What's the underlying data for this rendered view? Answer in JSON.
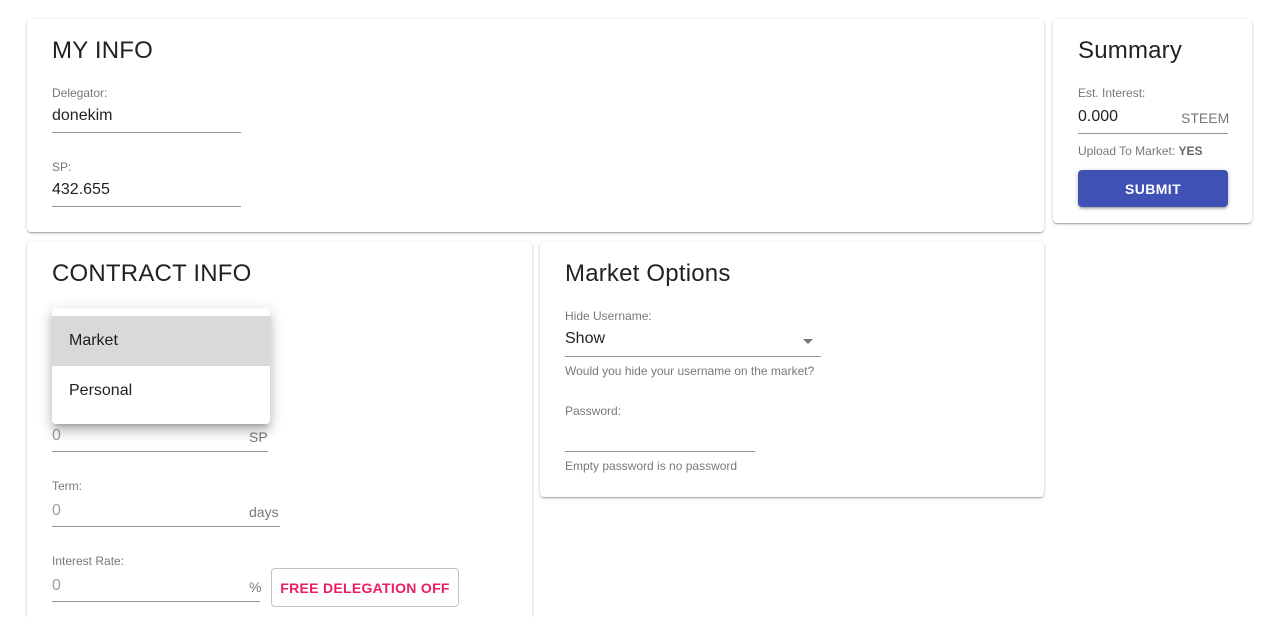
{
  "my_info": {
    "title": "MY INFO",
    "delegator": {
      "label": "Delegator:",
      "value": "donekim"
    },
    "sp": {
      "label": "SP:",
      "value": "432.655"
    }
  },
  "summary": {
    "title": "Summary",
    "est_interest": {
      "label": "Est. Interest:",
      "value": "0.000",
      "unit": "STEEM"
    },
    "upload_label": "Upload To Market:",
    "upload_value": "YES",
    "submit_label": "SUBMIT"
  },
  "contract_info": {
    "title": "CONTRACT INFO",
    "type_menu": {
      "options": [
        "Market",
        "Personal"
      ],
      "selected": "Market"
    },
    "amount": {
      "placeholder": "0",
      "unit": "SP"
    },
    "term": {
      "label": "Term:",
      "placeholder": "0",
      "unit": "days"
    },
    "interest_rate": {
      "label": "Interest Rate:",
      "placeholder": "0",
      "unit": "%"
    },
    "free_delegation_label": "FREE DELEGATION OFF"
  },
  "market_options": {
    "title": "Market Options",
    "hide_username": {
      "label": "Hide Username:",
      "value": "Show",
      "helper": "Would you hide your username on the market?"
    },
    "password": {
      "label": "Password:",
      "value": "",
      "helper": "Empty password is no password"
    }
  },
  "colors": {
    "primary": "#3f51b5",
    "secondary": "#e91e63",
    "menu_selected_bg": "#d9d9d9"
  }
}
